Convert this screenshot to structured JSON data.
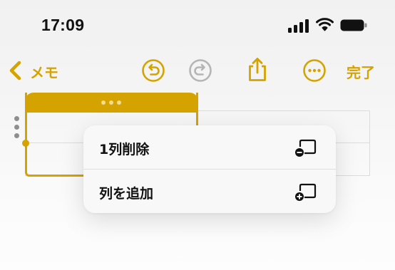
{
  "status_bar": {
    "time": "17:09"
  },
  "toolbar": {
    "back_label": "メモ",
    "done_label": "完了"
  },
  "context_menu": {
    "items": [
      {
        "label": "1列削除",
        "icon": "column-delete-icon"
      },
      {
        "label": "列を追加",
        "icon": "column-add-icon"
      }
    ]
  },
  "colors": {
    "accent": "#d4a300",
    "text": "#111111",
    "disabled": "#b5b5b5"
  }
}
